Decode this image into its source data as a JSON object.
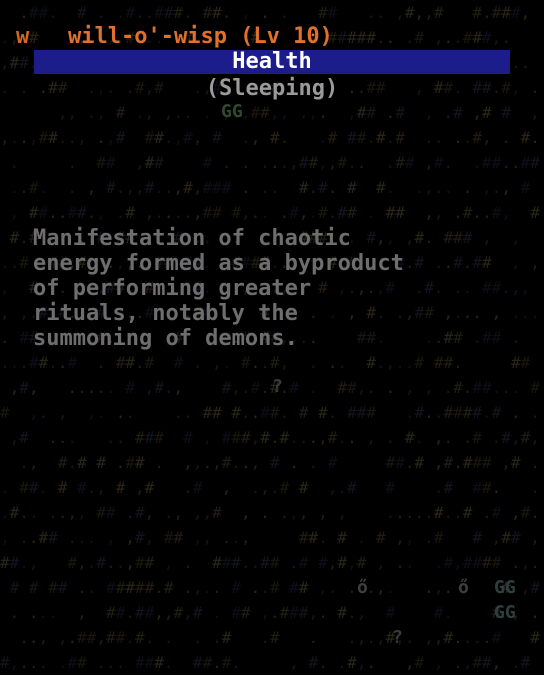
{
  "monster": {
    "glyph": "w",
    "name_level": "will-o'-wisp (Lv 10)",
    "health_label": "Health",
    "status": "(Sleeping)"
  },
  "description": {
    "lines": [
      "Manifestation of chaotic",
      "energy formed as a byproduct",
      "of performing greater",
      "rituals, notably the",
      "summoning of demons."
    ]
  },
  "map_glyphs": {
    "gg_top": "GG",
    "question": "?",
    "o_left": "ő",
    "o_right": "ő",
    "gg_right_1": "GG",
    "gg_right_2": "GG",
    "question_bottom": "?"
  },
  "colors": {
    "accent": "#e0702a",
    "health_bar": "#1c1c8a",
    "status_text": "#9a9a9a",
    "description_text": "#6e6e6e"
  }
}
